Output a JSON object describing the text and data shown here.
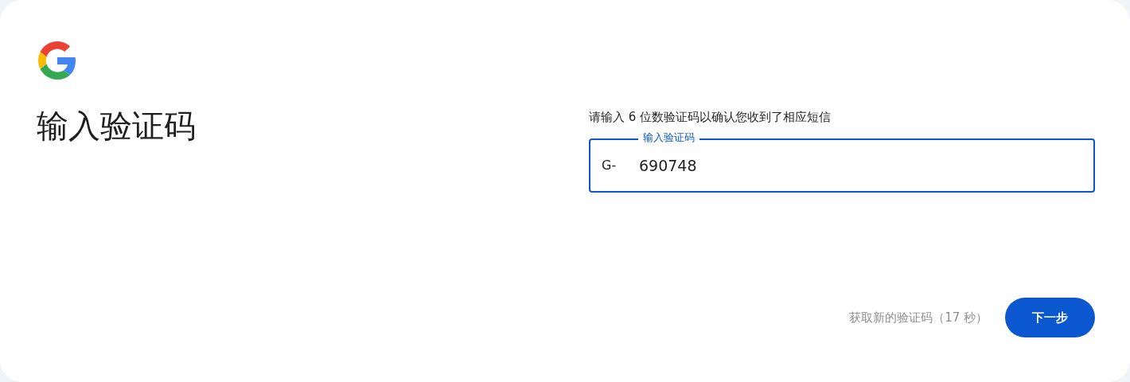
{
  "logo": {
    "kind": "google"
  },
  "title": "输入验证码",
  "instruction": "请输入 6 位数验证码以确认您收到了相应短信",
  "code_field": {
    "label": "输入验证码",
    "prefix": "G-",
    "value": "690748",
    "focused": true
  },
  "resend_link": {
    "label": "获取新的验证码（17 秒）",
    "disabled": true
  },
  "next_button": {
    "label": "下一步"
  }
}
